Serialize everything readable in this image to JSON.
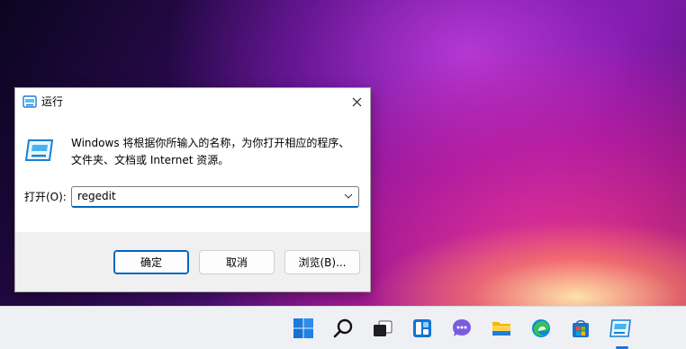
{
  "window": {
    "title": "运行",
    "description_line1": "Windows 将根据你所输入的名称，为你打开相应的程序、",
    "description_line2": "文件夹、文档或 Internet 资源。",
    "open_label": "打开(O):",
    "input_value": "regedit",
    "buttons": {
      "ok": "确定",
      "cancel": "取消",
      "browse": "浏览(B)..."
    }
  },
  "taskbar": {
    "icons": [
      "windows-start-icon",
      "search-icon",
      "task-view-icon",
      "widgets-icon",
      "chat-icon",
      "file-explorer-icon",
      "edge-icon",
      "store-icon",
      "run-app-icon"
    ]
  },
  "colors": {
    "accent": "#0067c0",
    "taskbar": "#eef0f4"
  }
}
